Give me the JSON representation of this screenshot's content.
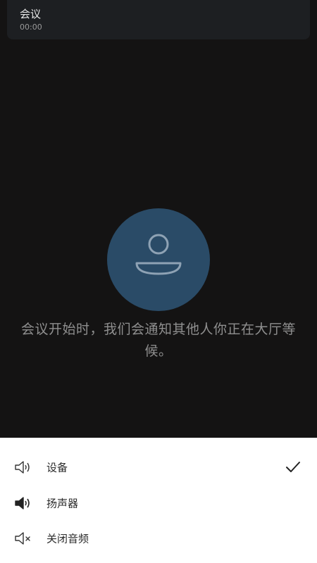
{
  "header": {
    "title": "会议",
    "timer": "00:00"
  },
  "avatar": {
    "icon": "person-icon",
    "color": "#2a4b67"
  },
  "lobby_message": "会议开始时，我们会通知其他人你正在大厅等候。",
  "audio_options": [
    {
      "label": "设备",
      "icon": "speaker-outline-icon",
      "selected": true
    },
    {
      "label": "扬声器",
      "icon": "speaker-filled-icon",
      "selected": false
    },
    {
      "label": "关闭音频",
      "icon": "speaker-muted-icon",
      "selected": false
    }
  ]
}
